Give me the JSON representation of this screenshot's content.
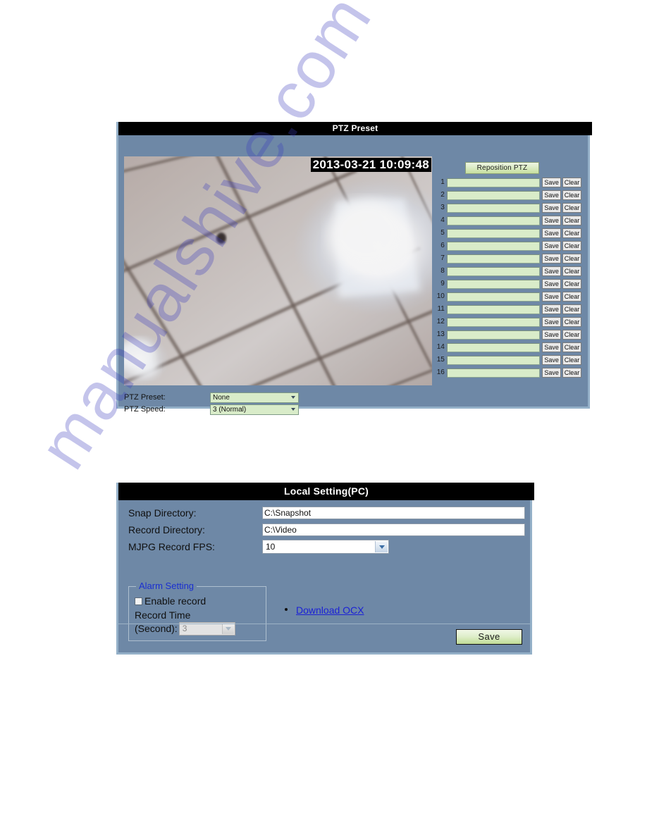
{
  "watermark": {
    "text": "manualshive.com"
  },
  "ptz_panel": {
    "title": "PTZ Preset",
    "video": {
      "timestamp": "2013-03-21 10:09:48",
      "description": "ceiling-tiles-with-bright-light"
    },
    "reposition_button": "Reposition PTZ",
    "preset_rows": [
      {
        "num": "1",
        "value": "",
        "save": "Save",
        "clear": "Clear"
      },
      {
        "num": "2",
        "value": "",
        "save": "Save",
        "clear": "Clear"
      },
      {
        "num": "3",
        "value": "",
        "save": "Save",
        "clear": "Clear"
      },
      {
        "num": "4",
        "value": "",
        "save": "Save",
        "clear": "Clear"
      },
      {
        "num": "5",
        "value": "",
        "save": "Save",
        "clear": "Clear"
      },
      {
        "num": "6",
        "value": "",
        "save": "Save",
        "clear": "Clear"
      },
      {
        "num": "7",
        "value": "",
        "save": "Save",
        "clear": "Clear"
      },
      {
        "num": "8",
        "value": "",
        "save": "Save",
        "clear": "Clear"
      },
      {
        "num": "9",
        "value": "",
        "save": "Save",
        "clear": "Clear"
      },
      {
        "num": "10",
        "value": "",
        "save": "Save",
        "clear": "Clear"
      },
      {
        "num": "11",
        "value": "",
        "save": "Save",
        "clear": "Clear"
      },
      {
        "num": "12",
        "value": "",
        "save": "Save",
        "clear": "Clear"
      },
      {
        "num": "13",
        "value": "",
        "save": "Save",
        "clear": "Clear"
      },
      {
        "num": "14",
        "value": "",
        "save": "Save",
        "clear": "Clear"
      },
      {
        "num": "15",
        "value": "",
        "save": "Save",
        "clear": "Clear"
      },
      {
        "num": "16",
        "value": "",
        "save": "Save",
        "clear": "Clear"
      }
    ],
    "controls": {
      "preset_label": "PTZ Preset:",
      "preset_value": "None",
      "speed_label": "PTZ Speed:",
      "speed_value": "3 (Normal)"
    }
  },
  "local_panel": {
    "title": "Local Setting(PC)",
    "snap_dir_label": "Snap Directory:",
    "snap_dir_value": "C:\\Snapshot",
    "record_dir_label": "Record Directory:",
    "record_dir_value": "C:\\Video",
    "mjpg_fps_label": "MJPG Record FPS:",
    "mjpg_fps_value": "10",
    "alarm": {
      "legend": "Alarm Setting",
      "enable_record_label": "Enable record",
      "enable_record_checked": false,
      "record_time_label_line1": "Record Time",
      "record_time_label_line2": "(Second):",
      "record_time_value": "3"
    },
    "ocx_link": "Download OCX",
    "save_label": "Save"
  },
  "colors": {
    "panel_bg": "#6e88a6",
    "panel_border": "#94b0c8",
    "title_bg": "#000000",
    "input_green": "#d9ecc9",
    "link_blue": "#1b21d6",
    "legend_blue": "#1a2fd0",
    "button_green": "#ddeec8"
  }
}
